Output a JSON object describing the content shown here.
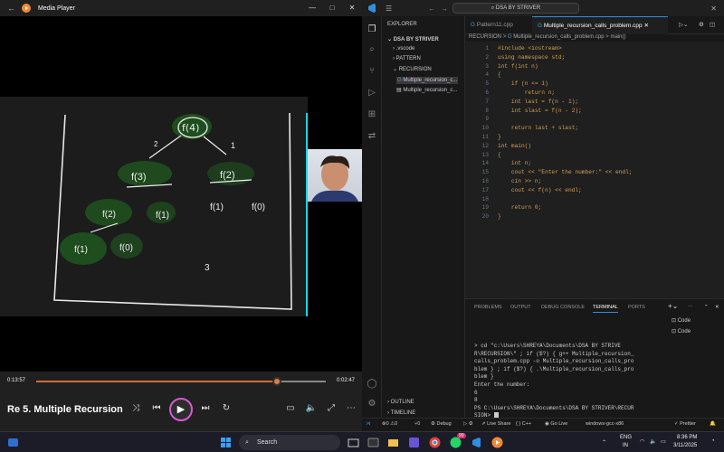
{
  "media_player": {
    "app_title": "Media Player",
    "window_controls": [
      "—",
      "□",
      "✕"
    ],
    "board_number": "3",
    "elapsed": "0:13:57",
    "remaining": "0:02:47",
    "progress": 0.83,
    "video_title": "Re 5. Multiple Recursion...",
    "icons": [
      "shuffle-icon",
      "previous-icon",
      "play-icon",
      "next-icon",
      "repeat-icon",
      "miniplayer-icon",
      "volume-icon",
      "fullscreen-icon",
      "more-icon"
    ]
  },
  "vscode": {
    "search_text": "DSA BY STRIVER",
    "explorer_label": "EXPLORER",
    "root_folder": "DSA BY STRIVER",
    "tree": [
      ".vscode",
      "PATTERN",
      "RECURSION",
      "Multiple_recursion_c...",
      "Multiple_recursion_c..."
    ],
    "tabs": [
      "Pattern11.cpp",
      "Multiple_recursion_calls_problem.cpp"
    ],
    "breadcrumb": [
      "RECURSION",
      ">",
      "Multiple_recursion_calls_problem.cpp",
      ">",
      "main()"
    ],
    "code_lines": [
      "#include <iostream>",
      "using namespace std;",
      "int f(int n)",
      "{",
      "    if (n <= 1)",
      "        return n;",
      "    int last = f(n - 1);",
      "    int slast = f(n - 2);",
      "",
      "    return last + slast;",
      "}",
      "int main()",
      "{",
      "    int n;",
      "    cout << \"Enter the number:\" << endl;",
      "    cin >> n;",
      "    cout << f(n) << endl;",
      "",
      "    return 0;",
      "}"
    ],
    "line_numbers": [
      "1",
      "2",
      "3",
      "4",
      "5",
      "6",
      "7",
      "8",
      "9",
      "10",
      "11",
      "12",
      "13",
      "14",
      "15",
      "16",
      "17",
      "18",
      "19",
      "20"
    ],
    "panel_tabs": [
      "PROBLEMS",
      "OUTPUT",
      "DEBUG CONSOLE",
      "TERMINAL",
      "PORTS"
    ],
    "active_panel_tab": "TERMINAL",
    "terminal_lines": [
      "   > cd \"c:\\Users\\SHREYA\\Documents\\DSA BY STRIVE",
      "R\\RECURSION\\\" ; if ($?) { g++ Multiple_recursion_",
      "calls_problem.cpp -o Multiple_recursion_calls_pro",
      "blem } ; if ($?) { .\\Multiple_recursion_calls_pro",
      "blem }",
      "Enter the number:",
      "6",
      "8",
      "PS C:\\Users\\SHREYA\\Documents\\DSA BY STRIVER\\RECUR",
      "SION> "
    ],
    "terminal_list": [
      "Code",
      "Code"
    ],
    "outline_label": "OUTLINE",
    "timeline_label": "TIMELINE",
    "status_items": [
      "⊗0 ⚠0",
      "⑂0",
      "Debug",
      "Live Share",
      "{ } C++",
      "Go Live",
      "windows-gcc-x86",
      "Prettier"
    ]
  },
  "taskbar": {
    "search_placeholder": "Search",
    "badge_count": "99",
    "lang": "ENG",
    "region": "IN",
    "time": "8:36 PM",
    "date": "3/11/2025"
  }
}
